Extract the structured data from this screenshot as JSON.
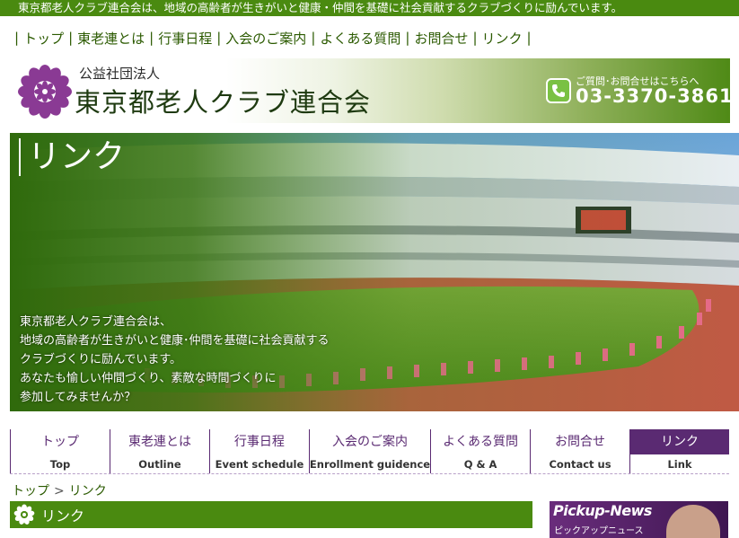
{
  "topbar": {
    "tagline": "東京都老人クラブ連合会は、地域の高齢者が生きがいと健康・仲間を基礎に社会貢献するクラブづくりに励んでいます。"
  },
  "text_nav": {
    "items": [
      "トップ",
      "東老連とは",
      "行事日程",
      "入会のご案内",
      "よくある質問",
      "お問合せ",
      "リンク"
    ]
  },
  "header": {
    "org_type": "公益社団法人",
    "org_name": "東京都老人クラブ連合会",
    "contact_label": "ご質問･お問合せはこちらへ",
    "phone": "03-3370-3861"
  },
  "hero": {
    "title": "リンク",
    "lines": [
      "東京都老人クラブ連合会は、",
      "地域の高齢者が生きがいと健康･仲間を基礎に社会貢献する",
      "クラブづくりに励んでいます。",
      "あなたも愉しい仲間づくり、素敵な時間づくりに",
      "参加してみませんか？"
    ]
  },
  "global_nav": {
    "items": [
      {
        "jp": "トップ",
        "en": "Top"
      },
      {
        "jp": "東老連とは",
        "en": "Outline"
      },
      {
        "jp": "行事日程",
        "en": "Event schedule"
      },
      {
        "jp": "入会のご案内",
        "en": "Enrollment guidence"
      },
      {
        "jp": "よくある質問",
        "en": "Q & A"
      },
      {
        "jp": "お問合せ",
        "en": "Contact us"
      },
      {
        "jp": "リンク",
        "en": "Link"
      }
    ],
    "active_index": 6
  },
  "breadcrumb": {
    "home": "トップ",
    "separator": ">",
    "current": "リンク"
  },
  "section": {
    "title": "リンク"
  },
  "pickup": {
    "title_en": "Pickup-News",
    "title_jp": "ピックアップニュース"
  },
  "colors": {
    "green": "#4a8a10",
    "purple": "#5a2a72",
    "nav_text": "#2b5a00"
  },
  "icons": {
    "logo": "chrysanthemum-icon",
    "phone": "phone-icon",
    "section": "chrysanthemum-icon"
  }
}
